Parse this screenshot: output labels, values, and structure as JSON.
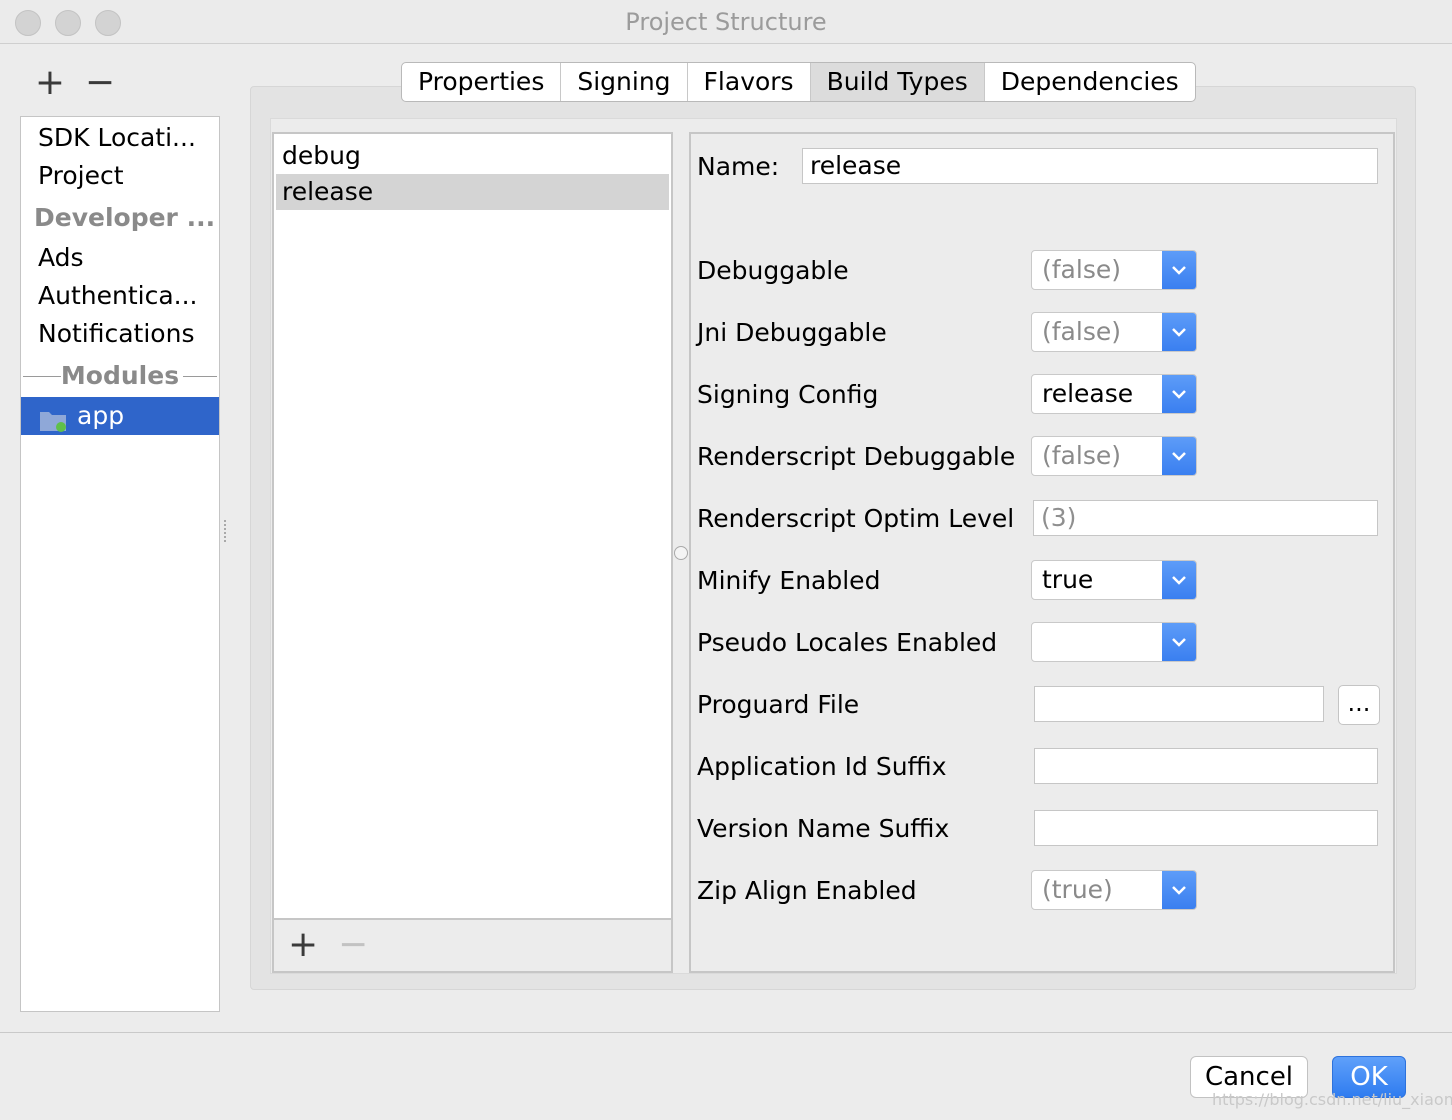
{
  "window": {
    "title": "Project Structure"
  },
  "sidebar": {
    "add_label": "+",
    "remove_label": "−",
    "items": {
      "sdk": "SDK Locati...",
      "project": "Project",
      "developer": "Developer ...",
      "ads": "Ads",
      "auth": "Authentica...",
      "notifications": "Notifications",
      "modules": "Modules",
      "app": "app"
    },
    "selected": "app"
  },
  "tabs": {
    "properties": "Properties",
    "signing": "Signing",
    "flavors": "Flavors",
    "build_types": "Build Types",
    "dependencies": "Dependencies",
    "active": "Build Types"
  },
  "build_types": {
    "items": [
      "debug",
      "release"
    ],
    "selected": "release",
    "add_label": "+",
    "remove_label": "−"
  },
  "form": {
    "name_label": "Name:",
    "name_value": "release",
    "debuggable": {
      "label": "Debuggable",
      "value": "(false)"
    },
    "jni_debuggable": {
      "label": "Jni Debuggable",
      "value": "(false)"
    },
    "signing_config": {
      "label": "Signing Config",
      "value": "release"
    },
    "renderscript_debuggable": {
      "label": "Renderscript Debuggable",
      "value": "(false)"
    },
    "renderscript_optim_level": {
      "label": "Renderscript Optim Level",
      "value": "(3)"
    },
    "minify_enabled": {
      "label": "Minify Enabled",
      "value": "true"
    },
    "pseudo_locales_enabled": {
      "label": "Pseudo Locales Enabled",
      "value": ""
    },
    "proguard_file": {
      "label": "Proguard File",
      "value": "",
      "browse_label": "..."
    },
    "application_id_suffix": {
      "label": "Application Id Suffix",
      "value": ""
    },
    "version_name_suffix": {
      "label": "Version Name Suffix",
      "value": ""
    },
    "zip_align_enabled": {
      "label": "Zip Align Enabled",
      "value": "(true)"
    }
  },
  "footer": {
    "cancel_label": "Cancel",
    "ok_label": "OK"
  },
  "watermark": "https://blog.csdn.net/liu_xiaomo",
  "colors": {
    "selection_blue": "#2f65ca",
    "combo_arrow_blue": "#3a7ff0",
    "ok_button_blue": "#2f7cf0"
  }
}
